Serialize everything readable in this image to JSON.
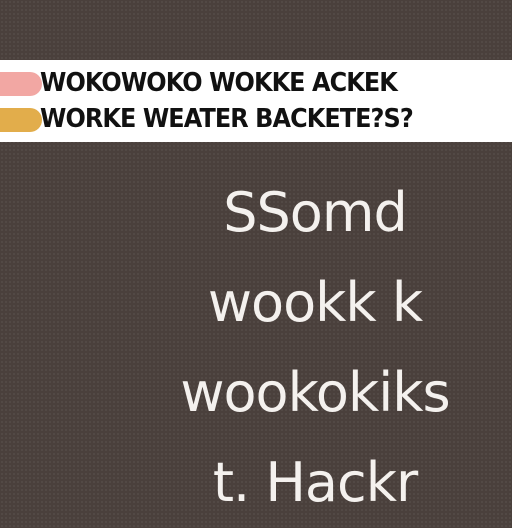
{
  "banner": {
    "line1": "WOKOWOKO WOKKE ACKEK",
    "line2": "WORKE WEATER BACKETE?S?",
    "colors": {
      "background": "#ffffff",
      "stripe_top": "#f2a7a3",
      "stripe_bottom": "#e2ad4b"
    }
  },
  "body_text": {
    "lines": [
      "SSomd",
      "wookk k",
      "wookokiks",
      "t. Hackr"
    ]
  },
  "colors": {
    "background": "#4a403c",
    "text": "#f4f1ee"
  }
}
